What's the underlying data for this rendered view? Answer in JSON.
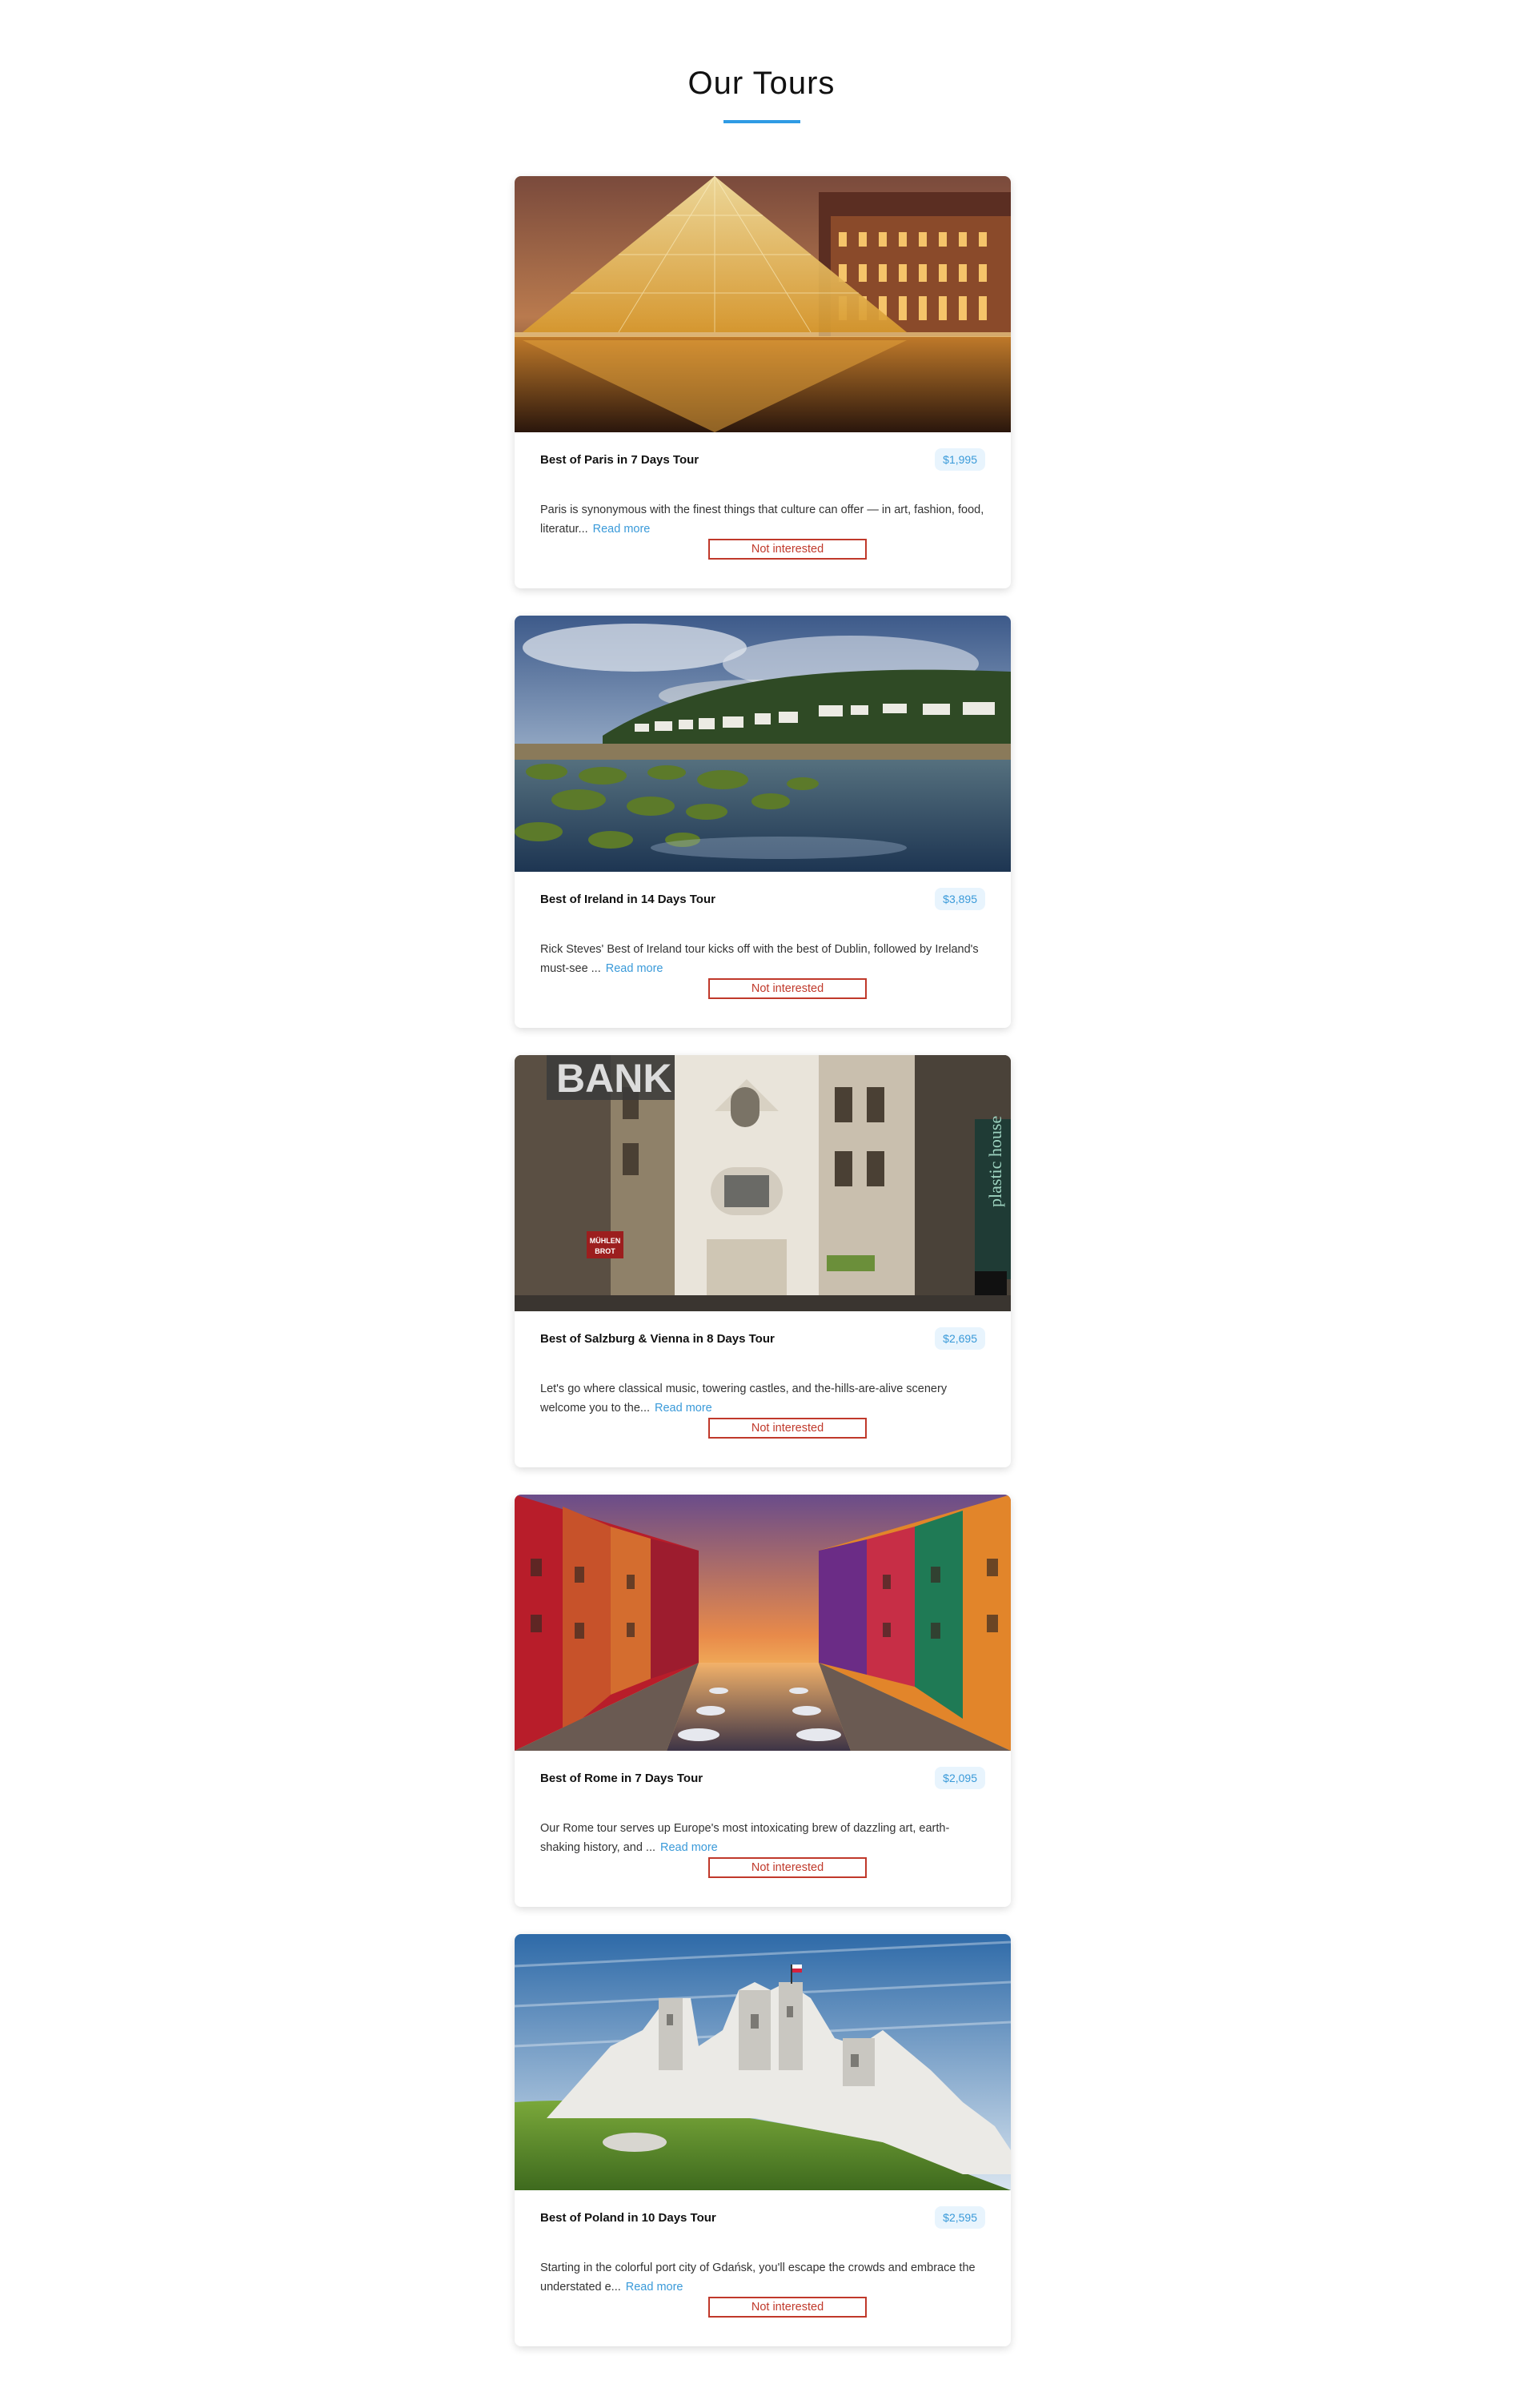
{
  "section": {
    "title": "Our Tours"
  },
  "tours": [
    {
      "name": "Best of Paris in 7 Days Tour",
      "price": "$1,995",
      "description": "Paris is synonymous with the finest things that culture can offer — in art, fashion, food, literatur...",
      "read_more": "Read more",
      "not_interested": "Not interested",
      "image_subject": "Louvre glass pyramid lit at dusk"
    },
    {
      "name": "Best of Ireland in 14 Days Tour",
      "price": "$3,895",
      "description": "Rick Steves' Best of Ireland tour kicks off with the best of Dublin, followed by Ireland's must-see ...",
      "read_more": "Read more",
      "not_interested": "Not interested",
      "image_subject": "Coastal village with mossy rocks and cloudy sky"
    },
    {
      "name": "Best of Salzburg & Vienna in 8 Days Tour",
      "price": "$2,695",
      "description": "Let's go where classical music, towering castles, and the-hills-are-alive scenery welcome you to the...",
      "read_more": "Read more",
      "not_interested": "Not interested",
      "image_subject": "City street with ornate buildings and BANK sign",
      "image_texts": {
        "bank_sign": "BANK",
        "side_sign": "plastic house",
        "shop_sign": "MÜHLEN BROT"
      }
    },
    {
      "name": "Best of Rome in 7 Days Tour",
      "price": "$2,095",
      "description": "Our Rome tour serves up Europe's most intoxicating brew of dazzling art, earth-shaking history, and ...",
      "read_more": "Read more",
      "not_interested": "Not interested",
      "image_subject": "Colorful canal houses at sunset"
    },
    {
      "name": "Best of Poland in 10 Days Tour",
      "price": "$2,595",
      "description": "Starting in the colorful port city of Gdańsk, you'll escape the crowds and embrace the understated e...",
      "read_more": "Read more",
      "not_interested": "Not interested",
      "image_subject": "White castle ruins on a green hill"
    }
  ]
}
